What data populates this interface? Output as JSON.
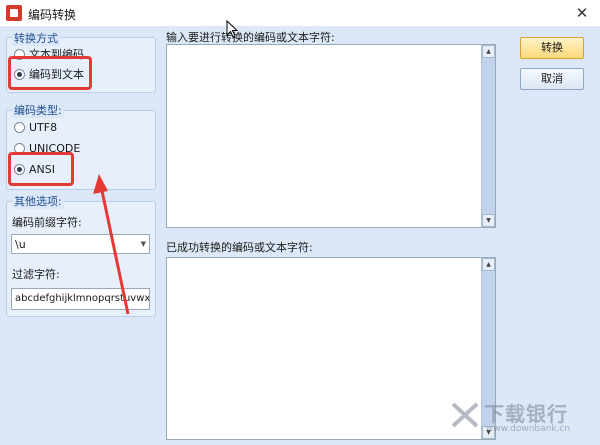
{
  "window": {
    "title": "编码转换",
    "close_label": "✕"
  },
  "convert_mode": {
    "title": "转换方式",
    "options": [
      {
        "label": "文本到编码",
        "checked": false
      },
      {
        "label": "编码到文本",
        "checked": true
      }
    ]
  },
  "encoding_type": {
    "title": "编码类型:",
    "options": [
      {
        "label": "UTF8",
        "checked": false
      },
      {
        "label": "UNICODE",
        "checked": false
      },
      {
        "label": "ANSI",
        "checked": true
      }
    ]
  },
  "other_options": {
    "title": "其他选项:",
    "prefix_label": "编码前缀字符:",
    "prefix_value": "\\u",
    "filter_label": "过滤字符:",
    "filter_value": "abcdefghijklmnopqrstuvwx"
  },
  "input_area": {
    "label": "输入要进行转换的编码或文本字符:",
    "value": ""
  },
  "output_area": {
    "label": "已成功转换的编码或文本字符:",
    "value": ""
  },
  "buttons": {
    "convert": "转换",
    "cancel": "取消"
  },
  "watermark": {
    "text": "下载银行",
    "url": "www.downbank.cn"
  },
  "colors": {
    "annotation": "#e53935",
    "panel_bg": "#dce8f7",
    "convert_button": "#fbd97a"
  }
}
